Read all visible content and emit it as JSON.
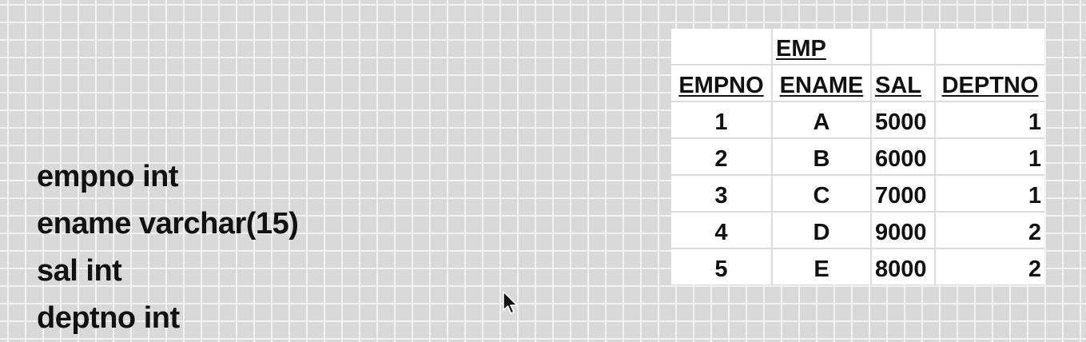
{
  "schema": {
    "fields": [
      "empno int",
      "ename varchar(15)",
      "sal int",
      "deptno int"
    ]
  },
  "table": {
    "title": "EMP",
    "headers": [
      "EMPNO",
      "ENAME",
      "SAL",
      "DEPTNO"
    ],
    "rows": [
      [
        "1",
        "A",
        "5000",
        "1"
      ],
      [
        "2",
        "B",
        "6000",
        "1"
      ],
      [
        "3",
        "C",
        "7000",
        "1"
      ],
      [
        "4",
        "D",
        "9000",
        "2"
      ],
      [
        "5",
        "E",
        "8000",
        "2"
      ]
    ]
  },
  "colors": {
    "grid_background": "#d9d9d9",
    "grid_lines": "#f2f2f2",
    "sheet_background": "#ffffff",
    "text": "#111111"
  },
  "icons": [
    "mouse-pointer-icon"
  ]
}
